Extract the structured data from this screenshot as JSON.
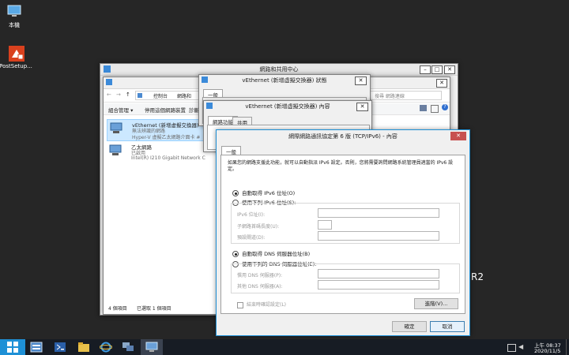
{
  "desktop": {
    "icons": [
      {
        "label": "本機"
      },
      {
        "label": "PostSetup..."
      }
    ],
    "watermark": "R2"
  },
  "network_center": {
    "title": "網路和共用中心"
  },
  "connections": {
    "address_path": [
      "控制台",
      "網路和"
    ],
    "search_placeholder": "搜尋 網路連線",
    "toolbar": [
      "組合管理 ▾",
      "停用這個網路裝置",
      "診斷"
    ],
    "items": [
      {
        "name": "vEthernet (新增虛擬交換器)",
        "status": "無法辨識的網路",
        "device": "Hyper-V 虛擬乙太網路介面卡 #"
      },
      {
        "name": "乙太網路",
        "status": "已啟用",
        "device": "Intel(R) I210 Gigabit Network C"
      }
    ],
    "status_items": "4 個項目",
    "status_selected": "已選取 1 個項目"
  },
  "status_dialog": {
    "title": "vEthernet (新增虛擬交換器) 狀態",
    "tab": "一般"
  },
  "props_dialog": {
    "title": "vEthernet (新增虛擬交換器) 內容",
    "tabs": [
      "網路功能",
      "共用"
    ]
  },
  "ipv6_dialog": {
    "title": "網際網路通訊協定第 6 版 (TCP/IPv6) - 內容",
    "tab": "一般",
    "description": "如果您的網路支援此功能，就可以自動指派 IPv6 設定。否則，您將需要詢問網路系統管理員適當的 IPv6 設定。",
    "auto_ip_label": "自動取得 IPv6 位址(O)",
    "manual_ip_label": "使用下列 IPv6 位址(S):",
    "ipv6_address_label": "IPv6 位址(I):",
    "prefix_label": "子網路首碼長度(U):",
    "gateway_label": "預設閘道(D):",
    "auto_dns_label": "自動取得 DNS 伺服器位址(B)",
    "manual_dns_label": "使用下列的 DNS 伺服器位址(E):",
    "preferred_dns_label": "慣用 DNS 伺服器(P):",
    "alternate_dns_label": "其他 DNS 伺服器(A):",
    "validate_label": "結束時確認設定(L)",
    "advanced_button": "進階(V)...",
    "ok_button": "確定",
    "cancel_button": "取消",
    "close_glyph": "✕"
  },
  "taskbar": {
    "time": "上午 08:37",
    "date": "2020/11/5"
  },
  "colors": {
    "desktop": "#262626",
    "taskbar": "#171c24",
    "start": "#1e90d6",
    "close_red": "#c75050",
    "selection": "#cce8ff"
  }
}
